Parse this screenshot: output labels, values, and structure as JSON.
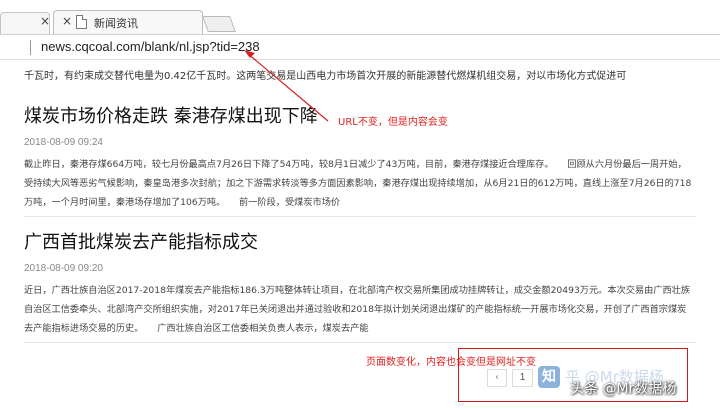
{
  "browser": {
    "tabs": [
      {
        "title": "",
        "close": "×"
      },
      {
        "title": "新闻资讯",
        "close": "×",
        "active": true
      }
    ],
    "url": "news.cqcoal.com/blank/nl.jsp?tid=238"
  },
  "content": {
    "top_snippet": "千瓦时，有约束成交替代电量为0.42亿千瓦时。这两笔交易是山西电力市场首次开展的新能源替代燃煤机组交易，对以市场化方式促进可",
    "articles": [
      {
        "title": "煤炭市场价格走跌 秦港存煤出现下降",
        "date": "2018-08-09 09:24",
        "body": "截止昨日，秦港存煤664万吨，较七月份最高点7月26日下降了54万吨，较8月1日减少了43万吨，目前，秦港存煤接近合理库存。　　回顾从六月份最后一周开始，受持续大风等恶劣气候影响，秦皇岛港多次封航；加之下游需求转淡等多方面因素影响，秦港存煤出现持续增加，从6月21日的612万吨，直线上涨至7月26日的718万吨，一个月时间里，秦港场存增加了106万吨。　　前一阶段，受煤炭市场价"
      },
      {
        "title": "广西首批煤炭去产能指标成交",
        "date": "2018-08-09 09:20",
        "body": "近日，广西壮族自治区2017-2018年煤炭去产能指标186.3万吨整体转让项目，在北部湾产权交易所集团成功挂牌转让，成交金额20493万元。本次交易由广西壮族自治区工信委牵头、北部湾产交所组织实施，对2017年已关闭退出并通过验收和2018年拟计划关闭退出煤矿的产能指标统一开展市场化交易，开创了广西首宗煤炭去产能指标进场交易的历史。　　广西壮族自治区工信委相关负责人表示，煤炭去产能"
      }
    ]
  },
  "annotations": {
    "url_note": "URL不变，但是内容会变",
    "page_note": "页面数变化，内容也会变但是网址不变",
    "color": "#e02020"
  },
  "pagination": {
    "prev": "‹",
    "current": "1"
  },
  "watermark": {
    "logo": "知",
    "faded": "乎 @Mr数据杨",
    "text": "头条 @Mr数据杨"
  }
}
